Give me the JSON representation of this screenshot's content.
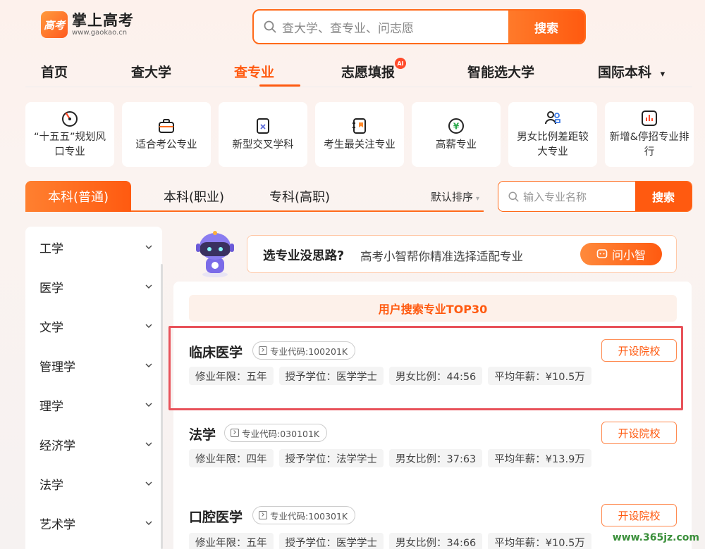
{
  "header": {
    "logo_mark": "高考",
    "logo_name": "掌上高考",
    "logo_url": "www.gaokao.cn",
    "search_placeholder": "查大学、查专业、问志愿",
    "search_button": "搜索"
  },
  "nav": {
    "items": [
      {
        "label": "首页"
      },
      {
        "label": "查大学"
      },
      {
        "label": "查专业",
        "active": true
      },
      {
        "label": "志愿填报",
        "badge": "AI"
      },
      {
        "label": "智能选大学"
      },
      {
        "label": "国际本科",
        "caret": "▾"
      }
    ]
  },
  "cards": [
    {
      "label": "“十五五”规划风口专业",
      "icon": "target-icon"
    },
    {
      "label": "适合考公专业",
      "icon": "briefcase-icon"
    },
    {
      "label": "新型交叉学科",
      "icon": "document-cross-icon"
    },
    {
      "label": "考生最关注专业",
      "icon": "notebook-icon"
    },
    {
      "label": "高薪专业",
      "icon": "yen-coin-icon"
    },
    {
      "label": "男女比例差距较大专业",
      "icon": "users-icon"
    },
    {
      "label": "新增&停招专业排行",
      "icon": "bar-chart-icon"
    }
  ],
  "tabs": {
    "items": [
      "本科(普通)",
      "本科(职业)",
      "专科(高职)"
    ],
    "sort_label": "默认排序"
  },
  "major_search": {
    "placeholder": "输入专业名称",
    "button": "搜索"
  },
  "sidebar": {
    "items": [
      "工学",
      "医学",
      "文学",
      "管理学",
      "理学",
      "经济学",
      "法学",
      "艺术学"
    ]
  },
  "assistant": {
    "question": "选专业没思路?",
    "subtitle": "高考小智帮你精准选择适配专业",
    "button": "问小智"
  },
  "results": {
    "title": "用户搜索专业TOP30",
    "majors": [
      {
        "name": "临床医学",
        "code": "专业代码:100201K",
        "years": "修业年限：五年",
        "degree": "授予学位：医学学士",
        "ratio": "男女比例：44:56",
        "salary": "平均年薪：¥10.5万",
        "button": "开设院校"
      },
      {
        "name": "法学",
        "code": "专业代码:030101K",
        "years": "修业年限：四年",
        "degree": "授予学位：法学学士",
        "ratio": "男女比例：37:63",
        "salary": "平均年薪：¥13.9万",
        "button": "开设院校"
      },
      {
        "name": "口腔医学",
        "code": "专业代码:100301K",
        "years": "修业年限：五年",
        "degree": "授予学位：医学学士",
        "ratio": "男女比例：34:66",
        "salary": "平均年薪：¥10.5万",
        "button": "开设院校"
      }
    ]
  },
  "watermark": "www.365jz.com",
  "colors": {
    "accent": "#ff5a10",
    "highlight_border": "#e8525a"
  }
}
